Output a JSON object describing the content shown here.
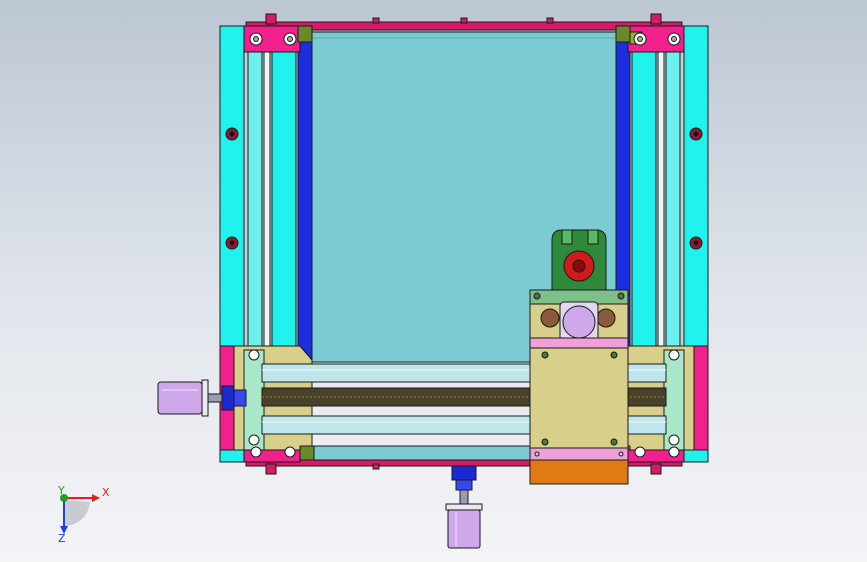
{
  "viewport": {
    "background_top": "#bcc6d2",
    "background_bottom": "#f3f4f6"
  },
  "colors": {
    "outline": "#1a1a1a",
    "cyan_rail": "#22f2ee",
    "blue_guide": "#1c2ee0",
    "pink_corner": "#f0208c",
    "window_fill": "#7ccad2",
    "tan_block": "#d8d08a",
    "green_mount": "#2e8a3a",
    "red_knob": "#d21a1a",
    "lilac_motor": "#cfa8ec",
    "orange_plate": "#e07a14",
    "bearing_brown": "#8a5a3a",
    "screw_dark": "#4a4228",
    "gray_frame": "#c8d0d2"
  },
  "triad": {
    "x_label": "X",
    "y_label": "Y",
    "z_label": "Z",
    "x_color": "#e02020",
    "y_color": "#20a020",
    "z_color": "#2040e0"
  },
  "icons": {
    "triad": "coordinate-triad-icon"
  }
}
